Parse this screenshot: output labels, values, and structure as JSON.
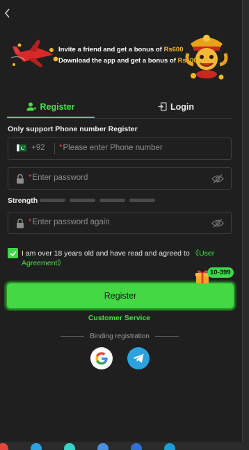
{
  "header": {
    "back_icon": "chevron-left-icon"
  },
  "banner": {
    "line1_prefix": "Invite a friend and get a bonus of ",
    "line1_amount": "Rs600",
    "line2_prefix": "Download the app and get a bonus of ",
    "line2_amount": "Rs100"
  },
  "tabs": [
    {
      "label": "Register",
      "icon": "user-plus-icon",
      "active": true
    },
    {
      "label": "Login",
      "icon": "login-door-icon",
      "active": false
    }
  ],
  "form": {
    "notice": "Only support Phone number Register",
    "phone": {
      "country_code": "+92",
      "required_mark": "*",
      "placeholder": "Please enter Phone number",
      "flag": "pakistan-flag-icon"
    },
    "password": {
      "required_mark": "*",
      "placeholder": "Enter password"
    },
    "strength_label": "Strength",
    "password_confirm": {
      "required_mark": "*",
      "placeholder": "Enter password again"
    },
    "agreement_text": "I am over 18 years old and have read and agreed to ",
    "agreement_link": "《User Agreement》",
    "agreement_checked": true,
    "submit_label": "Register",
    "gift_badge": "10-399"
  },
  "footer": {
    "customer_service": "Customer Service",
    "binding_label": "Binding registration",
    "social": [
      "google-icon",
      "telegram-icon"
    ]
  },
  "colors": {
    "accent": "#48e047",
    "background": "#1f1f1f",
    "bonus_amount": "#f5b727"
  }
}
